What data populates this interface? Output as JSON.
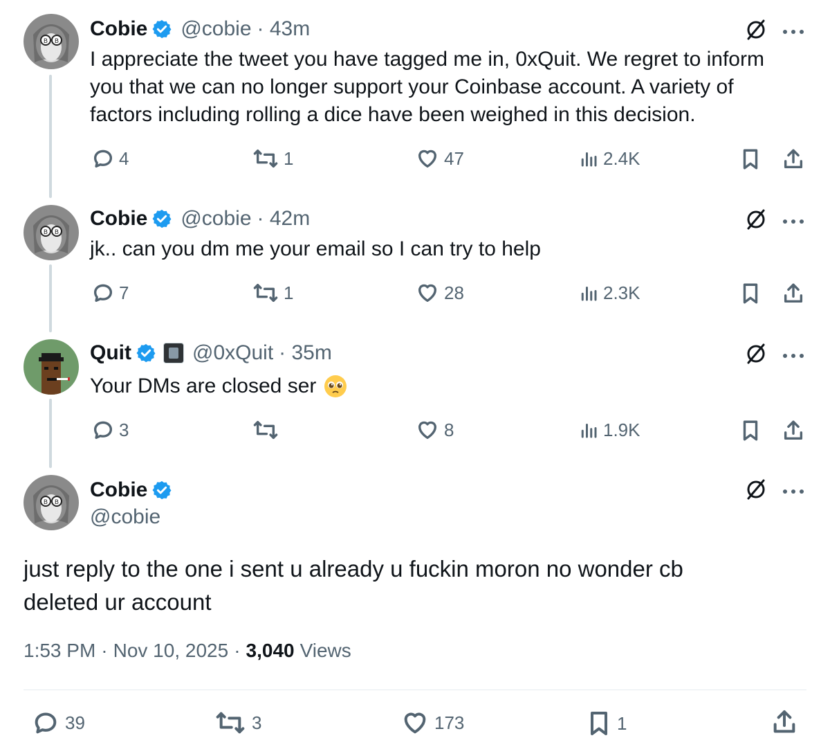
{
  "tweets": [
    {
      "name": "Cobie",
      "handle": "@cobie",
      "time": "· 43m",
      "text_lines": [
        "I appreciate the tweet you have tagged me in, 0xQuit. We regret to inform",
        "you that we can no longer support your Coinbase account. A variety of",
        "factors including rolling a dice have been weighed in this decision."
      ],
      "replies": "4",
      "reposts": "1",
      "likes": "47",
      "views": "2.4K"
    },
    {
      "name": "Cobie",
      "handle": "@cobie",
      "time": "· 42m",
      "text_lines": [
        "jk.. can you dm me your email so I can try to help"
      ],
      "replies": "7",
      "reposts": "1",
      "likes": "28",
      "views": "2.3K"
    },
    {
      "name": "Quit",
      "handle": "@0xQuit",
      "time": "· 35m",
      "text_lines": [
        "Your DMs are closed ser"
      ],
      "replies": "3",
      "reposts": "",
      "likes": "8",
      "views": "1.9K"
    }
  ],
  "main": {
    "name": "Cobie",
    "handle": "@cobie",
    "text_lines": [
      "just reply to the one i sent u already u fuckin moron no wonder cb",
      "deleted ur account"
    ],
    "time": "1:53 PM",
    "date": "Nov 10, 2025",
    "views_count": "3,040",
    "views_label": "Views",
    "replies": "39",
    "reposts": "3",
    "likes": "173",
    "bookmarks": "1"
  },
  "icons": {
    "more": "more-dots-icon",
    "grok": "grok-icon",
    "verified": "verified-badge-icon",
    "affiliate": "affiliate-badge-icon"
  },
  "colors": {
    "verified_blue": "#1d9bf0",
    "text": "#0f1419",
    "secondary": "#536471"
  }
}
